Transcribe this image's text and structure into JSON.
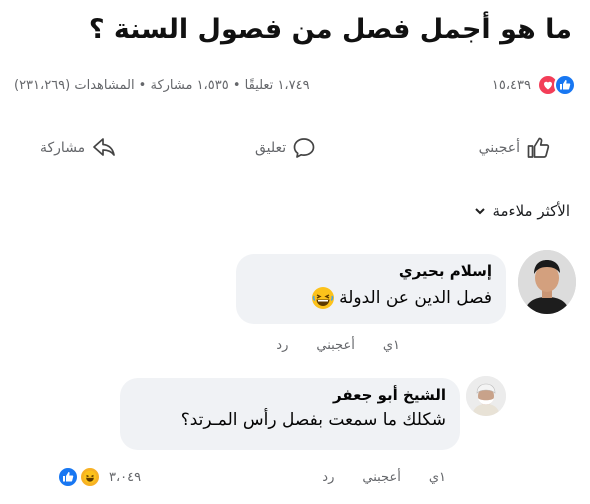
{
  "post": {
    "title": "ما هو أجمل فصل من فصول السنة ؟"
  },
  "stats": {
    "reactions_count": "١٥،٤٣٩",
    "summary": "١،٧٤٩ تعليقًا • ١،٥٣٥ مشاركة • المشاهدات (٢٣١،٢٦٩)"
  },
  "actions": {
    "like": "أعجبني",
    "comment": "تعليق",
    "share": "مشاركة"
  },
  "sort": {
    "label": "الأكثر ملاءمة"
  },
  "comments": [
    {
      "author": "إسلام بحيري",
      "text": "فصل الدين عن الدولة",
      "like": "أعجبني",
      "reply": "رد",
      "time": "١ي"
    },
    {
      "author": "الشيخ أبو جعفر",
      "text": "شكلك ما سمعت بفصل رأس المـرتد؟",
      "like": "أعجبني",
      "reply": "رد",
      "time": "١ي",
      "reactions_count": "٣،٠٤٩"
    }
  ],
  "colors": {
    "like": "#1877f2",
    "love": "#f33e58",
    "haha": "#f7b125",
    "muted": "#65676b",
    "bubble": "#f0f2f5"
  }
}
